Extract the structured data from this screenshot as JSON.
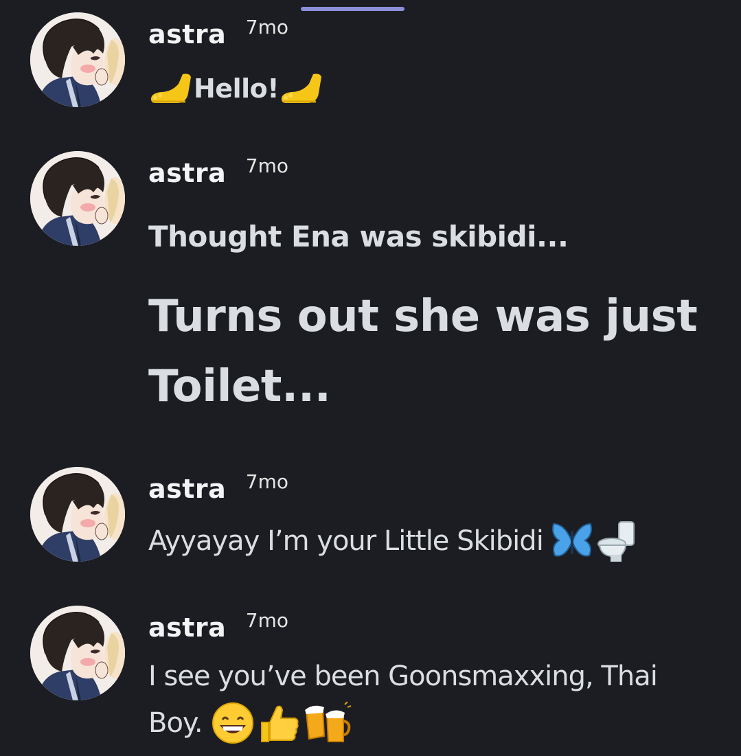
{
  "messages": [
    {
      "author": "astra",
      "time": "7mo",
      "text": "Hello!",
      "emoji_left": "foot-icon",
      "emoji_right": "foot-icon"
    },
    {
      "author": "astra",
      "time": "7mo",
      "heading_small": "Thought Ena was skibidi...",
      "heading_large_line1": "Turns out she was just",
      "heading_large_line2": "Toilet..."
    },
    {
      "author": "astra",
      "time": "7mo",
      "text": "Ayyayay I’m your Little Skibidi",
      "emoji_1": "butterfly-icon",
      "emoji_2": "toilet-icon"
    },
    {
      "author": "astra",
      "time": "7mo",
      "text_line1": "I see you’ve been Goonsmaxxing, Thai",
      "text_line2": "Boy.",
      "emoji_1": "grinning-face-icon",
      "emoji_2": "thumbs-up-icon",
      "emoji_3": "clinking-beer-mugs-icon"
    }
  ],
  "colors": {
    "background": "#1c1d22",
    "username": "#f2f3f5",
    "message_text": "#dbdee1",
    "scroll_indicator": "#8b8fd9"
  }
}
